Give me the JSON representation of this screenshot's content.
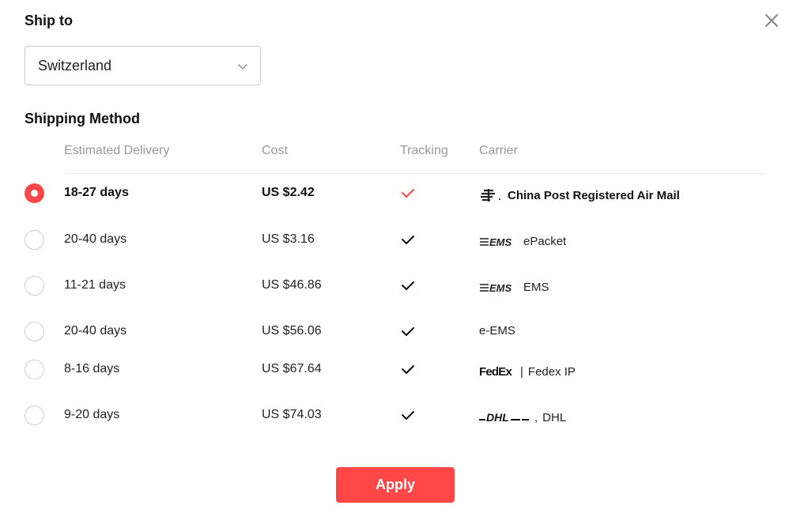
{
  "header": {
    "title": "Ship to",
    "close_icon": "close-icon"
  },
  "country_select": {
    "value": "Switzerland",
    "icon": "chevron-down-icon"
  },
  "section_title": "Shipping Method",
  "columns": {
    "delivery": "Estimated Delivery",
    "cost": "Cost",
    "tracking": "Tracking",
    "carrier": "Carrier"
  },
  "colors": {
    "accent": "#ff4747",
    "text": "#191919",
    "muted": "#999999",
    "border": "#c9c9c9"
  },
  "methods": [
    {
      "delivery": "18-27 days",
      "cost": "US $2.42",
      "tracking": true,
      "carrier": "China Post Registered Air Mail",
      "logo": "china-post-logo-icon",
      "selected": true
    },
    {
      "delivery": "20-40 days",
      "cost": "US $3.16",
      "tracking": true,
      "carrier": "ePacket",
      "logo": "ems-logo-icon",
      "selected": false
    },
    {
      "delivery": "11-21 days",
      "cost": "US $46.86",
      "tracking": true,
      "carrier": "EMS",
      "logo": "ems-logo-icon",
      "selected": false
    },
    {
      "delivery": "20-40 days",
      "cost": "US $56.06",
      "tracking": true,
      "carrier": "e-EMS",
      "logo": "",
      "selected": false
    },
    {
      "delivery": "8-16 days",
      "cost": "US $67.64",
      "tracking": true,
      "carrier": "Fedex IP",
      "logo": "fedex-logo-icon",
      "selected": false
    },
    {
      "delivery": "9-20 days",
      "cost": "US $74.03",
      "tracking": true,
      "carrier": "DHL",
      "logo": "dhl-logo-icon",
      "selected": false
    }
  ],
  "apply_label": "Apply"
}
